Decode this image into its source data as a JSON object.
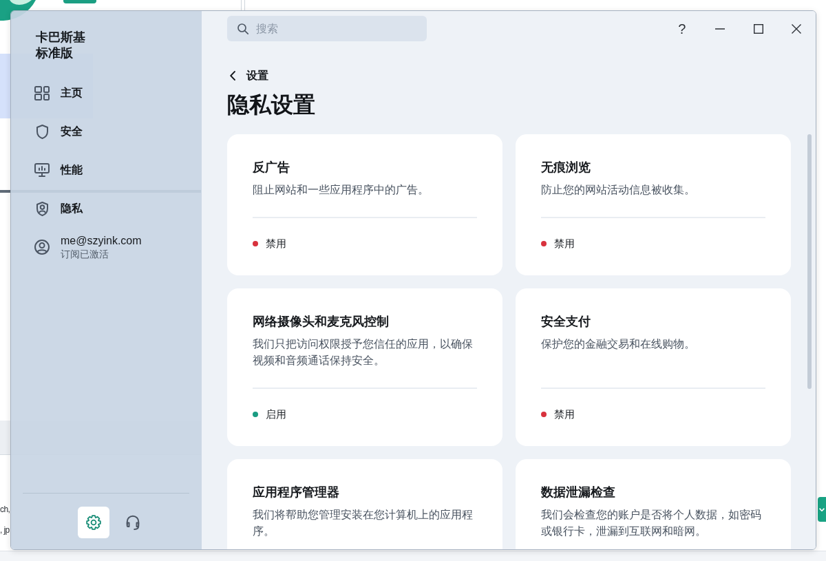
{
  "background_page": {
    "hint_lines": [
      "ch,",
      ", jp"
    ]
  },
  "window": {
    "sidebar": {
      "product": "卡巴斯基",
      "edition": "标准版",
      "nav_items": [
        {
          "kind": "home",
          "label": "主页",
          "selected": false
        },
        {
          "kind": "security",
          "label": "安全",
          "selected": false
        },
        {
          "kind": "performance",
          "label": "性能",
          "selected": false
        },
        {
          "kind": "privacy",
          "label": "隐私",
          "selected": false
        }
      ],
      "account": {
        "email": "me@szyink.com",
        "status": "订阅已激活"
      },
      "footer_buttons": [
        {
          "kind": "settings",
          "selected": true
        },
        {
          "kind": "support",
          "selected": false
        }
      ]
    },
    "search": {
      "placeholder": "搜索"
    },
    "title_bar_buttons": [
      {
        "kind": "help",
        "label": "?"
      },
      {
        "kind": "minimize"
      },
      {
        "kind": "maximize"
      },
      {
        "kind": "close"
      }
    ],
    "breadcrumb": {
      "label": "设置"
    },
    "page_title": "隐私设置",
    "cards": [
      {
        "title": "反广告",
        "description": "阻止网站和一些应用程序中的广告。",
        "on": false,
        "status": "禁用"
      },
      {
        "title": "无痕浏览",
        "description": "防止您的网站活动信息被收集。",
        "on": false,
        "status": "禁用"
      },
      {
        "title": "网络摄像头和麦克风控制",
        "description": "我们只把访问权限授予您信任的应用，以确保视频和音频通话保持安全。",
        "on": true,
        "status": "启用"
      },
      {
        "title": "安全支付",
        "description": "保护您的金融交易和在线购物。",
        "on": false,
        "status": "禁用"
      },
      {
        "title": "应用程序管理器",
        "description": "我们将帮助您管理安装在您计算机上的应用程序。"
      },
      {
        "title": "数据泄漏检查",
        "description": "我们会检查您的账户是否将个人数据，如密码或银行卡，泄漏到互联网和暗网。"
      }
    ]
  }
}
